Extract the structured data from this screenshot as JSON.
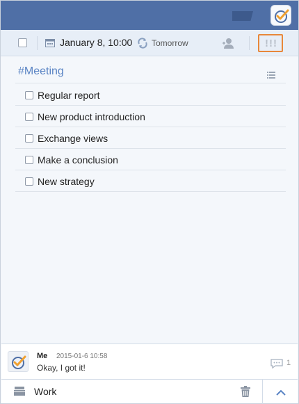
{
  "toolbar": {
    "date": "January 8, 10:00",
    "repeat": "Tomorrow",
    "priority_label": "!!!"
  },
  "task": {
    "title": "#Meeting",
    "checklist": [
      "Regular report",
      "New product introduction",
      "Exchange views",
      "Make a conclusion",
      "New strategy"
    ]
  },
  "comment": {
    "author": "Me",
    "time": "2015-01-6 10:58",
    "text": "Okay, I got it!",
    "count": "1"
  },
  "footer": {
    "list_name": "Work"
  },
  "colors": {
    "topbar": "#4f6fa6",
    "priority_highlight": "#e8873a",
    "title": "#5a84c4"
  }
}
